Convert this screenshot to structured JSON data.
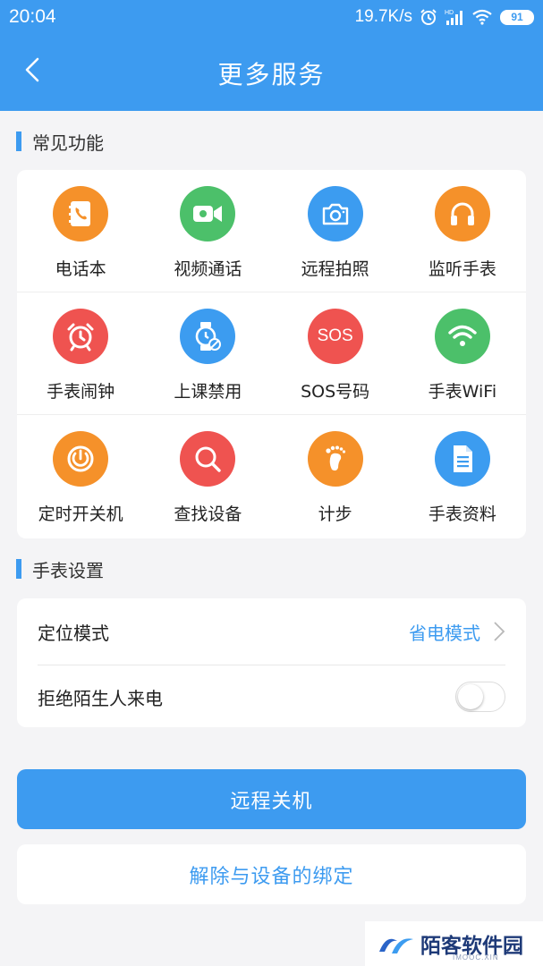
{
  "status_bar": {
    "time": "20:04",
    "speed": "19.7K/s",
    "battery": "91"
  },
  "header": {
    "title": "更多服务"
  },
  "common_functions": {
    "title": "常见功能",
    "items": [
      {
        "label": "电话本",
        "icon": "phonebook-icon",
        "color": "#f5912a"
      },
      {
        "label": "视频通话",
        "icon": "video-camera-icon",
        "color": "#4cc06a"
      },
      {
        "label": "远程拍照",
        "icon": "camera-icon",
        "color": "#3c9cf0"
      },
      {
        "label": "监听手表",
        "icon": "headphones-icon",
        "color": "#f5912a"
      },
      {
        "label": "手表闹钟",
        "icon": "alarm-clock-icon",
        "color": "#ef5350"
      },
      {
        "label": "上课禁用",
        "icon": "watch-disabled-icon",
        "color": "#3c9cf0"
      },
      {
        "label": "SOS号码",
        "icon": "sos-icon",
        "color": "#ef5350",
        "glyph": "SOS"
      },
      {
        "label": "手表WiFi",
        "icon": "wifi-icon",
        "color": "#4cc06a"
      },
      {
        "label": "定时开关机",
        "icon": "power-icon",
        "color": "#f5912a"
      },
      {
        "label": "查找设备",
        "icon": "search-icon",
        "color": "#ef5350"
      },
      {
        "label": "计步",
        "icon": "footprint-icon",
        "color": "#f5912a"
      },
      {
        "label": "手表资料",
        "icon": "document-icon",
        "color": "#3c9cf0"
      }
    ]
  },
  "watch_settings": {
    "title": "手表设置",
    "location_mode_label": "定位模式",
    "location_mode_value": "省电模式",
    "reject_strangers_label": "拒绝陌生人来电",
    "reject_strangers_enabled": false
  },
  "actions": {
    "remote_shutdown": "远程关机",
    "unbind": "解除与设备的绑定"
  },
  "watermark": {
    "text": "陌客软件园",
    "sub": "IMOOC.XIN"
  },
  "colors": {
    "accent": "#3d9bf0",
    "orange": "#f5912a",
    "green": "#4cc06a",
    "red": "#ef5350"
  }
}
